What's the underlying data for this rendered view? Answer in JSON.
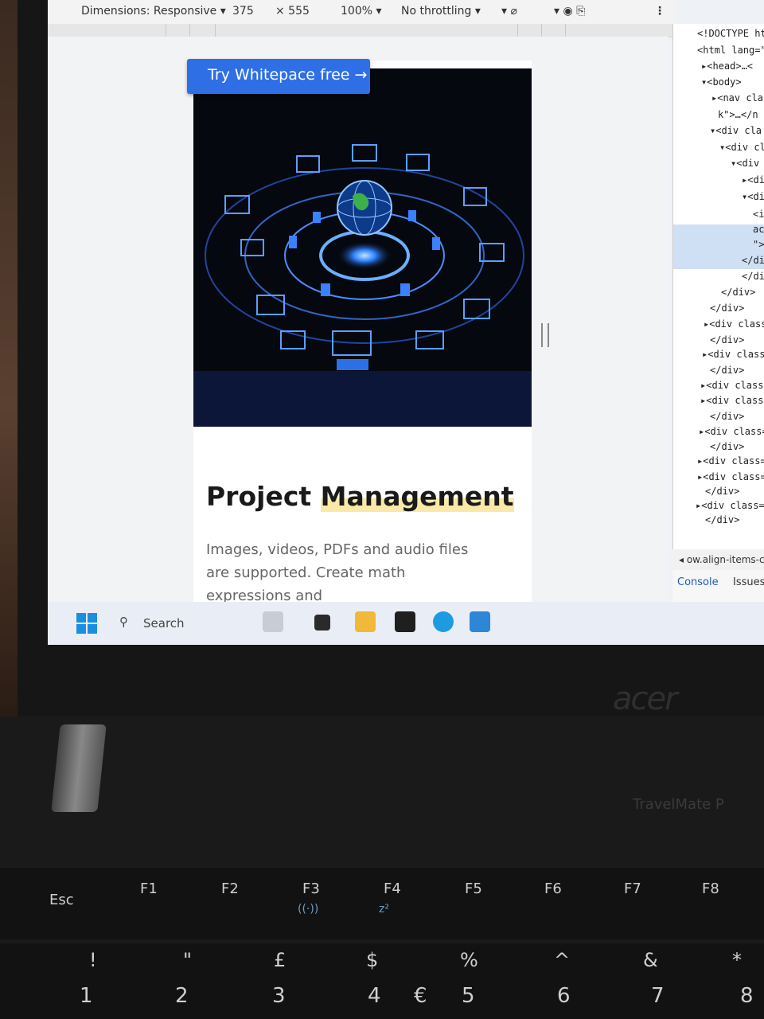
{
  "devtools": {
    "dimensions_label": "Dimensions: Responsive",
    "width": "375",
    "height": "× 555",
    "zoom": "100%",
    "throttling": "No throttling"
  },
  "page": {
    "cta_label": "Try Whitepace free →",
    "title_part1": "Project",
    "title_part2": "Management",
    "description": "Images, videos, PDFs and audio files are supported. Create math expressions and"
  },
  "elements_panel": {
    "lines": [
      "<!DOCTYPE ht",
      "<html lang=\"",
      "▸<head>…<",
      "▾<body>",
      "▸<nav cla",
      "k\">…</n",
      "▾<div cla",
      "▾<div cl",
      "▾<div",
      "▸<di",
      "▾<div",
      "<i",
      "ac",
      "\">",
      "</di",
      "</div>",
      "</div>",
      "</div>",
      "▸<div class",
      "</div>",
      "▸<div class=",
      "</div>",
      "▸<div class=",
      "▸<div class=",
      "</div>",
      "▸<div class=",
      "</div>",
      "▸<div class=\"",
      "▸<div class=\"",
      "</div>",
      "▸<div class=\"",
      "</div>"
    ],
    "breadcrumb": "ow.align-items-cen",
    "tab_console": "Console",
    "tab_issues": "Issues"
  },
  "taskbar": {
    "search_label": "Search"
  },
  "laptop": {
    "brand": "acer",
    "model": "TravelMate P"
  },
  "keyboard": {
    "fn_row": [
      "Esc",
      "F1",
      "F2",
      "F3",
      "F4",
      "F5",
      "F6",
      "F7",
      "F8"
    ],
    "fn_sub": [
      "",
      "",
      "",
      "((·))",
      "z²",
      "",
      "",
      "",
      ""
    ],
    "num_row_top": [
      "!",
      "\"",
      "£",
      "$",
      "%",
      "^",
      "&",
      "*"
    ],
    "num_row": [
      "1",
      "2",
      "3",
      "4",
      "€",
      "5",
      "6",
      "7",
      "8"
    ]
  }
}
